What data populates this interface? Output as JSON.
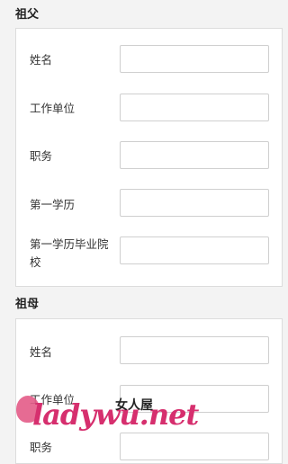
{
  "grandfather": {
    "title": "祖父",
    "fields": [
      {
        "label": "姓名",
        "value": ""
      },
      {
        "label": "工作单位",
        "value": ""
      },
      {
        "label": "职务",
        "value": ""
      },
      {
        "label": "第一学历",
        "value": ""
      },
      {
        "label": "第一学历毕业院校",
        "value": ""
      }
    ]
  },
  "grandmother": {
    "title": "祖母",
    "fields": [
      {
        "label": "姓名",
        "value": ""
      },
      {
        "label": "工作单位",
        "value": ""
      },
      {
        "label": "职务",
        "value": ""
      }
    ]
  },
  "watermark": {
    "text": "ladywu.net",
    "cn": "女人屋",
    "color": "#d62f6e"
  }
}
